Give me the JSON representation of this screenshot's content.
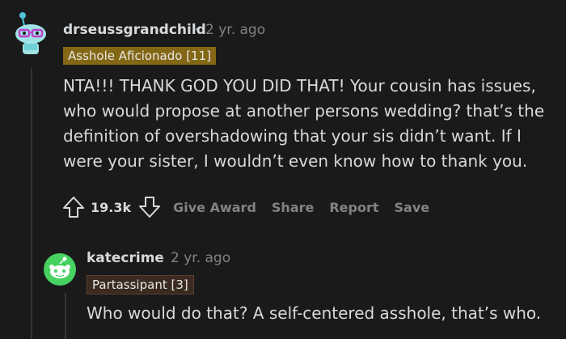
{
  "comments": [
    {
      "username": "drseussgrandchild",
      "separator": "·",
      "time": "2 yr. ago",
      "flair": "Asshole Aficionado [11]",
      "flair_color": "#836714",
      "body": "NTA!!! THANK GOD YOU DID THAT! Your cousin has issues, who would propose at another persons wedding? that’s the definition of overshadowing that your sis didn’t want. If I were your sister, I wouldn’t even know how to thank you.",
      "avatar_icon": "snoo-avatar-icon",
      "actions": {
        "vote_count": "19.3k",
        "give_award": "Give Award",
        "share": "Share",
        "report": "Report",
        "save": "Save"
      }
    },
    {
      "username": "katecrime",
      "separator": "·",
      "time": "2 yr. ago",
      "flair": "Partassipant [3]",
      "flair_color": "#3a2a1f",
      "body": "Who would do that? A self-centered asshole, that’s who.",
      "avatar_icon": "snoo-default-avatar-icon"
    }
  ],
  "colors": {
    "background": "#1a1a1b",
    "text": "#d7dadc",
    "muted": "#818384",
    "thread_line": "#343536",
    "avatar_green": "#46d160"
  }
}
